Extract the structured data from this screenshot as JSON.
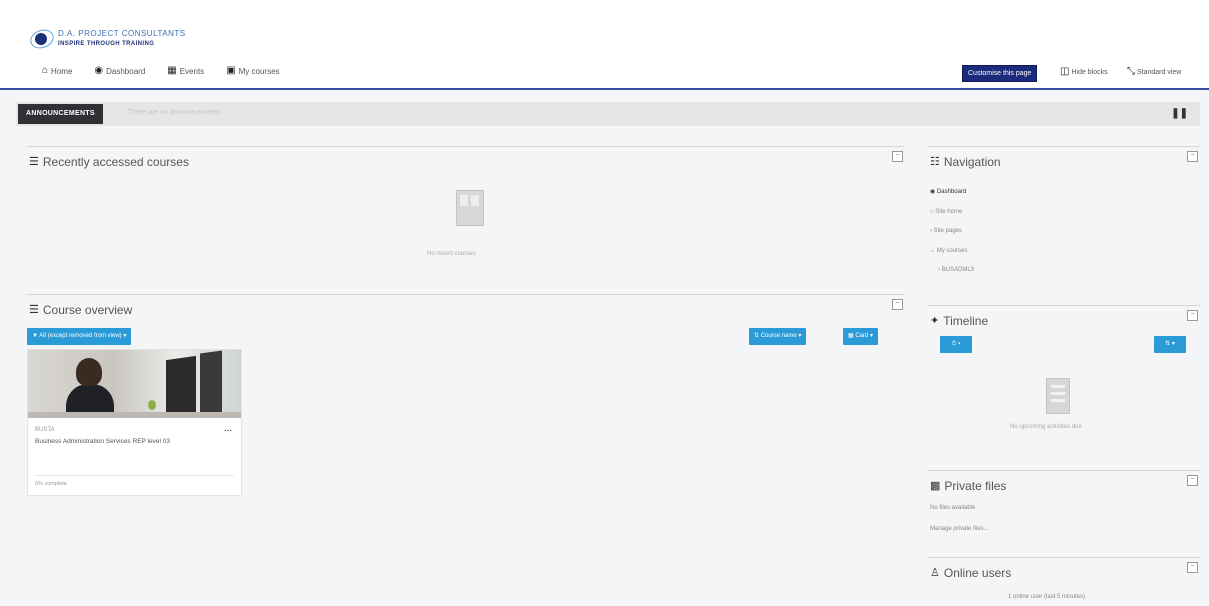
{
  "header": {
    "logo_line1": "D.A. PROJECT CONSULTANTS",
    "logo_line2": "INSPIRE THROUGH TRAINING",
    "nav": [
      {
        "label": "Home"
      },
      {
        "label": "Dashboard"
      },
      {
        "label": "Events"
      },
      {
        "label": "My courses"
      }
    ],
    "customize_label": "Customise this page",
    "hide_blocks_label": "Hide blocks",
    "standard_view_label": "Standard view"
  },
  "announcements": {
    "label": "ANNOUNCEMENTS",
    "text": "There are no announcements"
  },
  "recent_courses": {
    "title": "Recently accessed courses",
    "empty_text": "No recent courses"
  },
  "course_overview": {
    "title": "Course overview",
    "filter_label": "All (except removed from view)",
    "sort_label": "Course name",
    "view_label": "Card",
    "course": {
      "code": "BUSTA",
      "name": "Business Administration Services REP level 03",
      "progress_text": "0% complete"
    }
  },
  "navigation": {
    "title": "Navigation",
    "items": [
      {
        "label": "Dashboard"
      },
      {
        "label": "Site home"
      },
      {
        "label": "Site pages"
      },
      {
        "label": "My courses"
      },
      {
        "label": "BUSADML3"
      }
    ]
  },
  "timeline": {
    "title": "Timeline",
    "empty_text": "No upcoming activities due"
  },
  "private_files": {
    "title": "Private files",
    "empty_text": "No files available",
    "manage_label": "Manage private files..."
  },
  "online_users": {
    "title": "Online users",
    "status_text": "1 online user (last 5 minutes)"
  },
  "colors": {
    "brand": "#1b2a7a",
    "button_blue": "#2b9bd8",
    "announce_dark": "#2f3135"
  }
}
